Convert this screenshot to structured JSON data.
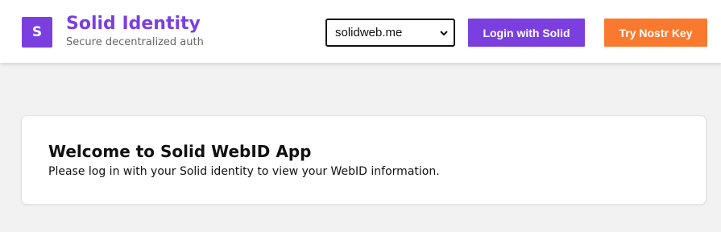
{
  "brand": {
    "logo_letter": "S",
    "title": "Solid Identity",
    "subtitle": "Secure decentralized auth"
  },
  "provider_select": {
    "selected": "solidweb.me"
  },
  "buttons": {
    "login_solid": "Login with Solid",
    "try_nostr": "Try Nostr Key"
  },
  "welcome": {
    "title": "Welcome to Solid WebID App",
    "message": "Please log in with your Solid identity to view your WebID information."
  },
  "colors": {
    "accent_purple": "#7b3fe0",
    "accent_orange": "#f97a2e",
    "page_background": "#f2f2f2"
  }
}
